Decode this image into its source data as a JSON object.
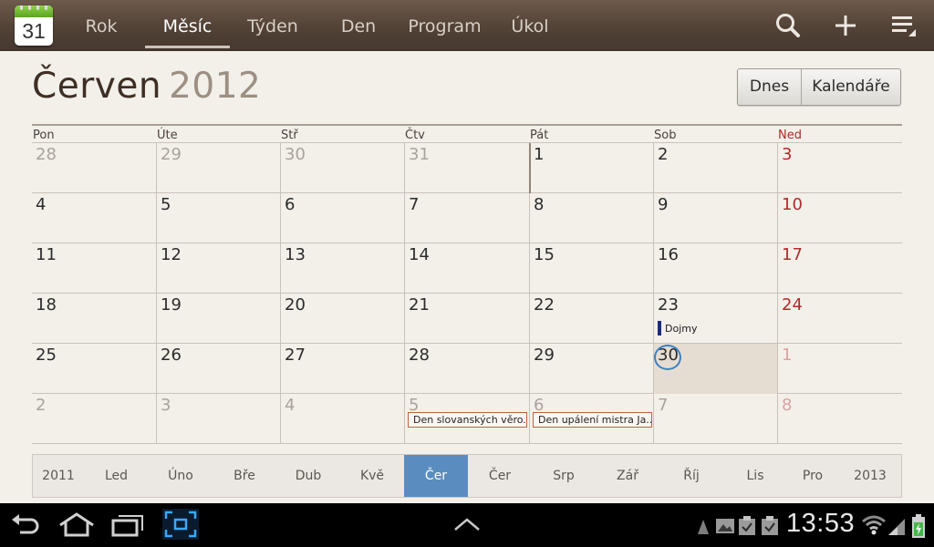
{
  "app_icon": {
    "day": "31",
    "icon": "calendar-app-icon"
  },
  "nav": {
    "tabs": [
      {
        "label": "Rok",
        "active": false
      },
      {
        "label": "Měsíc",
        "active": true
      },
      {
        "label": "Týden",
        "active": false
      },
      {
        "label": "Den",
        "active": false
      },
      {
        "label": "Program",
        "active": false
      },
      {
        "label": "Úkol",
        "active": false
      }
    ],
    "icons": [
      "search-icon",
      "add-icon",
      "menu-icon"
    ]
  },
  "header": {
    "month": "Červen",
    "year": "2012",
    "today_button": "Dnes",
    "calendars_button": "Kalendáře"
  },
  "calendar": {
    "weekdays": [
      "Pon",
      "Úte",
      "Stř",
      "Čtv",
      "Pát",
      "Sob",
      "Ned"
    ],
    "weeks": [
      [
        "28",
        "29",
        "30",
        "31",
        "1",
        "2",
        "3"
      ],
      [
        "4",
        "5",
        "6",
        "7",
        "8",
        "9",
        "10"
      ],
      [
        "11",
        "12",
        "13",
        "14",
        "15",
        "16",
        "17"
      ],
      [
        "18",
        "19",
        "20",
        "21",
        "22",
        "23",
        "24"
      ],
      [
        "25",
        "26",
        "27",
        "28",
        "29",
        "30",
        "1"
      ],
      [
        "2",
        "3",
        "4",
        "5",
        "6",
        "7",
        "8"
      ]
    ],
    "events": {
      "dojmy": "Dojmy",
      "slavic": "Den slovanských věro..",
      "hus": "Den upálení mistra Ja.."
    },
    "today": "30"
  },
  "month_strip": {
    "items": [
      "2011",
      "Led",
      "Úno",
      "Bře",
      "Dub",
      "Kvě",
      "Čer",
      "Čer",
      "Srp",
      "Zář",
      "Říj",
      "Lis",
      "Pro",
      "2013"
    ],
    "selected_index": 6
  },
  "system_bar": {
    "time": "13:53",
    "icons": [
      "back-icon",
      "home-icon",
      "recent-apps-icon",
      "screenshot-icon",
      "up-arrow-icon",
      "notification-icon",
      "gallery-icon",
      "task-icon",
      "task-done-icon",
      "wifi-icon",
      "signal-icon",
      "battery-icon"
    ]
  },
  "colors": {
    "accent": "#5a8cc0",
    "sunday": "#b02a2a",
    "topbar": "#524236",
    "today_bg": "#e6ddd2"
  }
}
